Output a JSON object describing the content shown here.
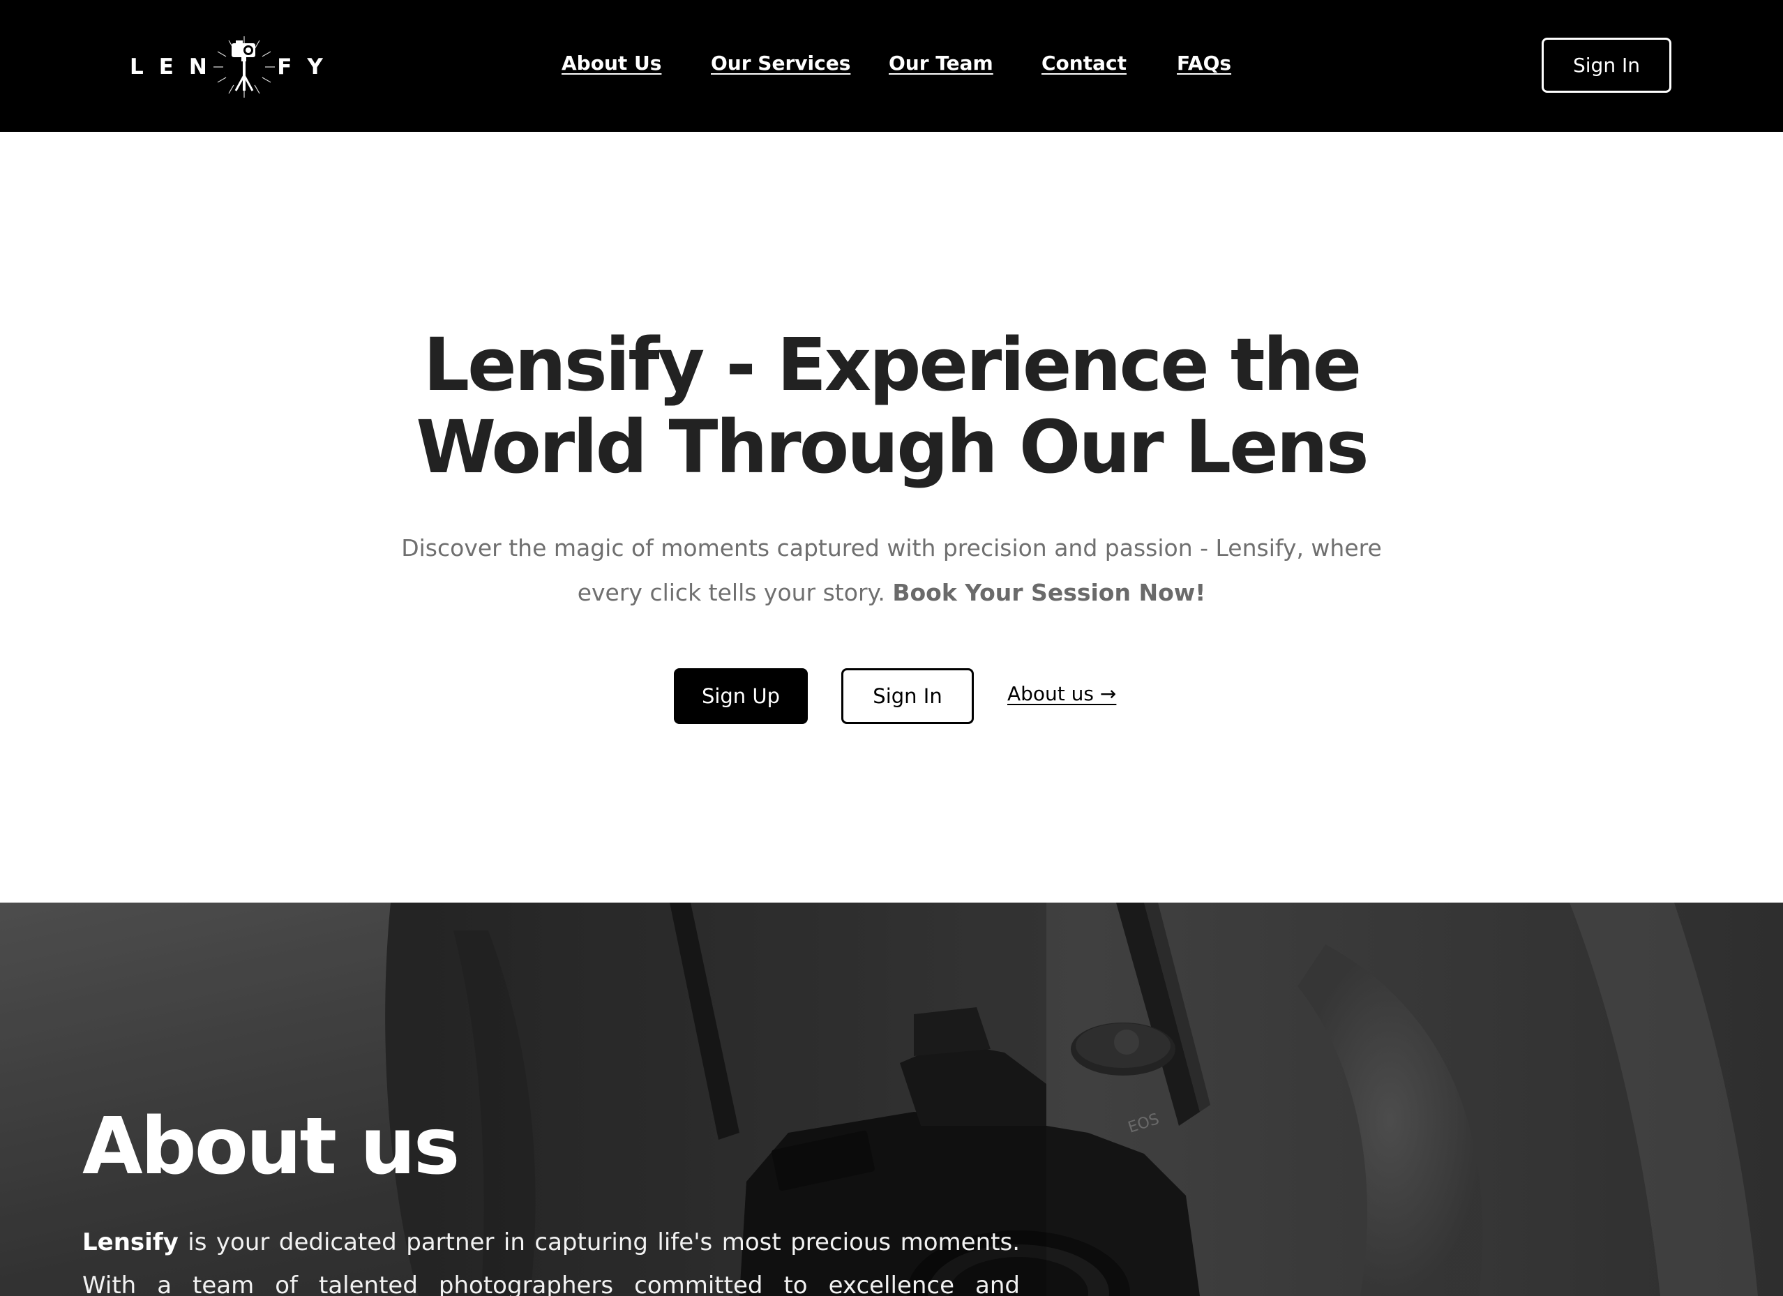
{
  "brand": {
    "name": "LENSIFY",
    "prefix": "LENS",
    "suffix": "FY"
  },
  "nav": {
    "links": [
      {
        "label": "About Us"
      },
      {
        "label": "Our Services"
      },
      {
        "label": "Our Team"
      },
      {
        "label": "Contact"
      },
      {
        "label": "FAQs"
      }
    ],
    "signin_label": "Sign In"
  },
  "hero": {
    "title_line1": "Lensify - Experience the",
    "title_line2": "World Through Our Lens",
    "subtitle": "Discover the magic of moments captured with precision and passion - Lensify, where every click tells your story.",
    "subtitle_cta": "Book Your Session Now!",
    "signup_label": "Sign Up",
    "signin_label": "Sign In",
    "about_link_label": "About us →"
  },
  "about": {
    "title": "About us",
    "brand_bold": "Lensify",
    "text": "is your dedicated partner in capturing life's most precious moments. With a team of talented photographers committed to excellence and creativity, we"
  },
  "colors": {
    "nav_background": "#000000",
    "hero_title": "#222222",
    "hero_subtitle": "#6f6f6f",
    "primary_button": "#000000",
    "about_text": "#ffffff"
  },
  "icons": {
    "logo_emblem": "camera-tripod-emblem-icon"
  }
}
